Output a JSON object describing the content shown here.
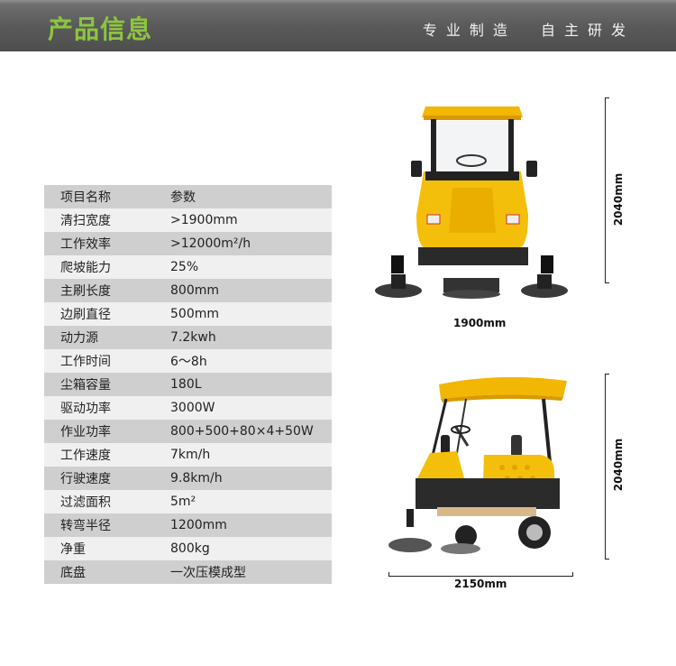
{
  "header": {
    "title": "产品信息",
    "slogan": [
      "专业制造",
      "自主研发"
    ]
  },
  "table": {
    "columns": [
      "项目名称",
      "参数"
    ],
    "rows": [
      {
        "label": "清扫宽度",
        "value": ">1900mm"
      },
      {
        "label": "工作效率",
        "value": ">12000m²/h"
      },
      {
        "label": "爬坡能力",
        "value": "25%"
      },
      {
        "label": "主刷长度",
        "value": "800mm"
      },
      {
        "label": "边刷直径",
        "value": "500mm"
      },
      {
        "label": "动力源",
        "value": "7.2kwh"
      },
      {
        "label": "工作时间",
        "value": "6～8h"
      },
      {
        "label": "尘箱容量",
        "value": "180L"
      },
      {
        "label": "驱动功率",
        "value": "3000W"
      },
      {
        "label": "作业功率",
        "value": "800+500+80×4+50W"
      },
      {
        "label": "工作速度",
        "value": "7km/h"
      },
      {
        "label": "行驶速度",
        "value": "9.8km/h"
      },
      {
        "label": "过滤面积",
        "value": "5m²"
      },
      {
        "label": "转弯半径",
        "value": "1200mm"
      },
      {
        "label": "净重",
        "value": "800kg"
      },
      {
        "label": "底盘",
        "value": "一次压模成型"
      }
    ]
  },
  "front_view": {
    "width_label": "1900mm",
    "height_label": "2040mm"
  },
  "side_view": {
    "length_label": "2150mm",
    "height_label": "2040mm"
  },
  "colors": {
    "accent": "#8cc63f",
    "machine_yellow": "#f2b705",
    "row_dark": "#cfcfcf",
    "row_light": "#f0f0f0"
  }
}
